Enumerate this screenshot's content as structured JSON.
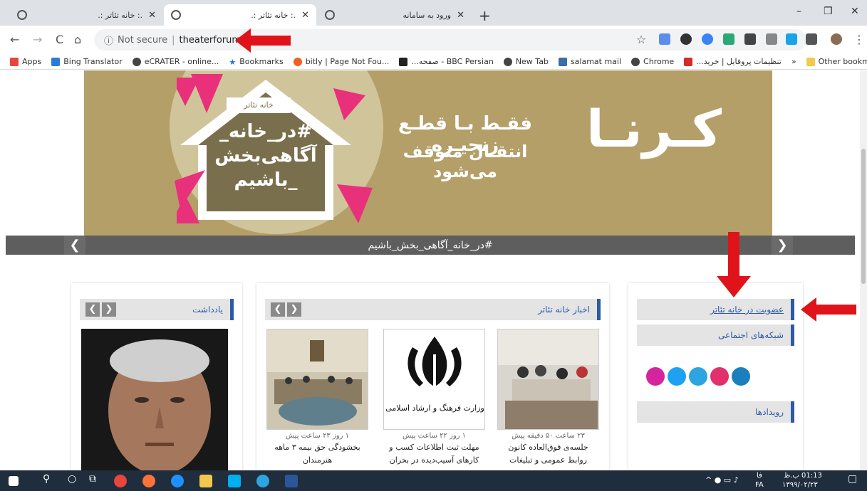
{
  "tabs": [
    {
      "title": ".: خانه تئاتر :."
    },
    {
      "title": ".: خانه تئاتر :."
    },
    {
      "title": "ورود به سامانه"
    }
  ],
  "window_controls": {
    "minimize": "–",
    "restore": "❐",
    "close": "✕"
  },
  "omnibox": {
    "security": "Not secure",
    "url": "theaterforum.ir"
  },
  "bookmarks": [
    {
      "label": "Apps",
      "color": "#e8453c"
    },
    {
      "label": "Bing Translator",
      "color": "#2b7bd3"
    },
    {
      "label": "eCRATER - online...",
      "color": "#444444"
    },
    {
      "label": "Bookmarks",
      "color": "#1a73e8"
    },
    {
      "label": "bitly | Page Not Fou...",
      "color": "#ee6123"
    },
    {
      "label": "BBC Persian - صفحه...",
      "color": "#222222"
    },
    {
      "label": "New Tab",
      "color": "#444444"
    },
    {
      "label": "salamat mail",
      "color": "#3a6ea5"
    },
    {
      "label": "Chrome",
      "color": "#444444"
    },
    {
      "label": "تنظیمات پروفایل | خرید...",
      "color": "#d62b2b"
    },
    {
      "label": "»",
      "color": ""
    },
    {
      "label": "Other bookmarks",
      "color": "#f2c94c"
    }
  ],
  "banner": {
    "logo": "خانه تئاتر",
    "house_text": "#در_خانه_ آگاهی‌بخش _باشیم",
    "line1": "فقـط بـا قطـع زنجیـره",
    "line2": "انتقـال متوقف می‌شود",
    "big": "کـرنـا",
    "caption": "#در_خانه_آگاهی_بخش_باشیم"
  },
  "panels": {
    "memo": {
      "title": "یادداشت"
    },
    "news": {
      "title": "اخبار خانه تئاتر",
      "items": [
        {
          "meta": "۲۳ ساعت ۵۰ دقیقه پیش",
          "title": "جلسه‌ی فوق‌العاده کانون روابط عمومی و تبلیغات"
        },
        {
          "meta": "۱ روز ۲۲ ساعت پیش",
          "title": "مهلت ثبت اطلاعات کسب و کارهای آسیب‌دیده در بحران"
        },
        {
          "meta": "۱ روز ۲۳ ساعت پیش",
          "title": "بخشودگی حق بیمه ۳ ماهه هنرمندان"
        }
      ],
      "ministry_caption": "وزارت فرهنگ و ارشاد اسلامی"
    },
    "sidebar": {
      "membership": "عضویت در خانه تئاتر",
      "social": "شبکه‌های اجتماعی",
      "events": "رویدادها"
    }
  },
  "tray": {
    "lang": "FA",
    "lang2": "فا",
    "time": "01:13 ب.ظ",
    "date": "۱۳۹۹/۰۲/۲۳"
  },
  "colors": {
    "accent": "#2d5aa8",
    "annotation": "#e0131a",
    "banner": "#b49f69",
    "taskbar": "#1f2d3d"
  }
}
